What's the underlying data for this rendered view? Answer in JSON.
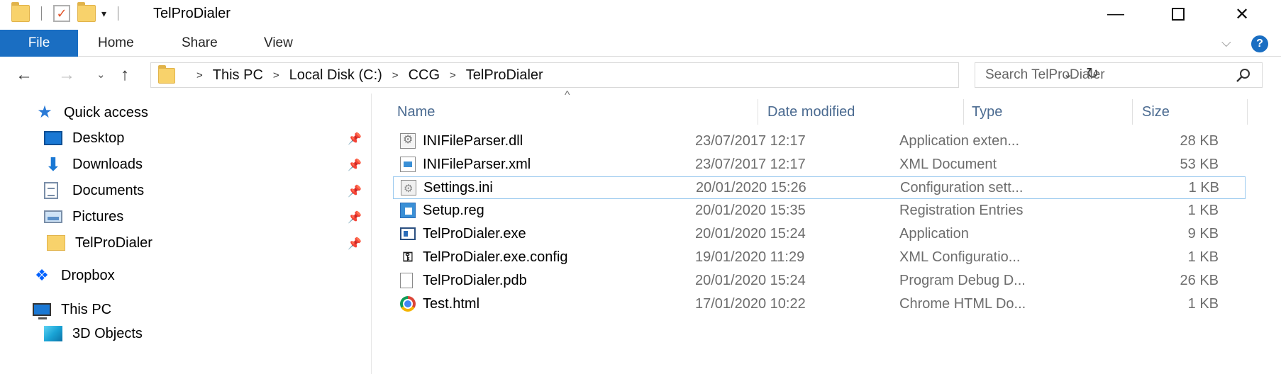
{
  "window": {
    "title": "TelProDialer",
    "min_glyph": "—",
    "close_glyph": "✕"
  },
  "qat": {
    "check_glyph": "✓",
    "customize_glyph": "▾"
  },
  "ribbon": {
    "tabs": [
      "File",
      "Home",
      "Share",
      "View"
    ],
    "collapse_glyph": "⌵",
    "help_glyph": "?"
  },
  "nav": {
    "back_glyph": "←",
    "forward_glyph": "→",
    "recent_glyph": "⌄",
    "up_glyph": "↑"
  },
  "address": {
    "crumbs": [
      "This PC",
      "Local Disk (C:)",
      "CCG",
      "TelProDialer"
    ],
    "separator_glyph": ">",
    "dropdown_glyph": "⌄",
    "refresh_glyph": "↻"
  },
  "search": {
    "placeholder": "Search TelProDialer"
  },
  "navpane": {
    "quick_access": "Quick access",
    "items": [
      {
        "label": "Desktop",
        "icon": "desktop-icon",
        "pinned": true
      },
      {
        "label": "Downloads",
        "icon": "downloads-icon",
        "pinned": true
      },
      {
        "label": "Documents",
        "icon": "documents-icon",
        "pinned": true
      },
      {
        "label": "Pictures",
        "icon": "pictures-icon",
        "pinned": true
      },
      {
        "label": "TelProDialer",
        "icon": "folder-icon",
        "pinned": true
      }
    ],
    "dropbox": "Dropbox",
    "this_pc": "This PC",
    "objects_3d": "3D Objects",
    "pin_glyph": "📌"
  },
  "filelist": {
    "columns": [
      "Name",
      "Date modified",
      "Type",
      "Size"
    ],
    "sort_glyph": "^",
    "rows": [
      {
        "name": "INIFileParser.dll",
        "date": "23/07/2017 12:17",
        "type": "Application exten...",
        "size": "28 KB",
        "icon": "dll-icon"
      },
      {
        "name": "INIFileParser.xml",
        "date": "23/07/2017 12:17",
        "type": "XML Document",
        "size": "53 KB",
        "icon": "xml-icon"
      },
      {
        "name": "Settings.ini",
        "date": "20/01/2020 15:26",
        "type": "Configuration sett...",
        "size": "1 KB",
        "icon": "ini-icon",
        "selected": true
      },
      {
        "name": "Setup.reg",
        "date": "20/01/2020 15:35",
        "type": "Registration Entries",
        "size": "1 KB",
        "icon": "reg-icon"
      },
      {
        "name": "TelProDialer.exe",
        "date": "20/01/2020 15:24",
        "type": "Application",
        "size": "9 KB",
        "icon": "exe-icon"
      },
      {
        "name": "TelProDialer.exe.config",
        "date": "19/01/2020 11:29",
        "type": "XML Configuratio...",
        "size": "1 KB",
        "icon": "config-icon"
      },
      {
        "name": "TelProDialer.pdb",
        "date": "20/01/2020 15:24",
        "type": "Program Debug D...",
        "size": "26 KB",
        "icon": "pdb-icon"
      },
      {
        "name": "Test.html",
        "date": "17/01/2020 10:22",
        "type": "Chrome HTML Do...",
        "size": "1 KB",
        "icon": "chrome-icon"
      }
    ]
  },
  "colors": {
    "accent": "#1a6ec2",
    "selection_border": "#99c9ef",
    "folder": "#f8d26b"
  }
}
